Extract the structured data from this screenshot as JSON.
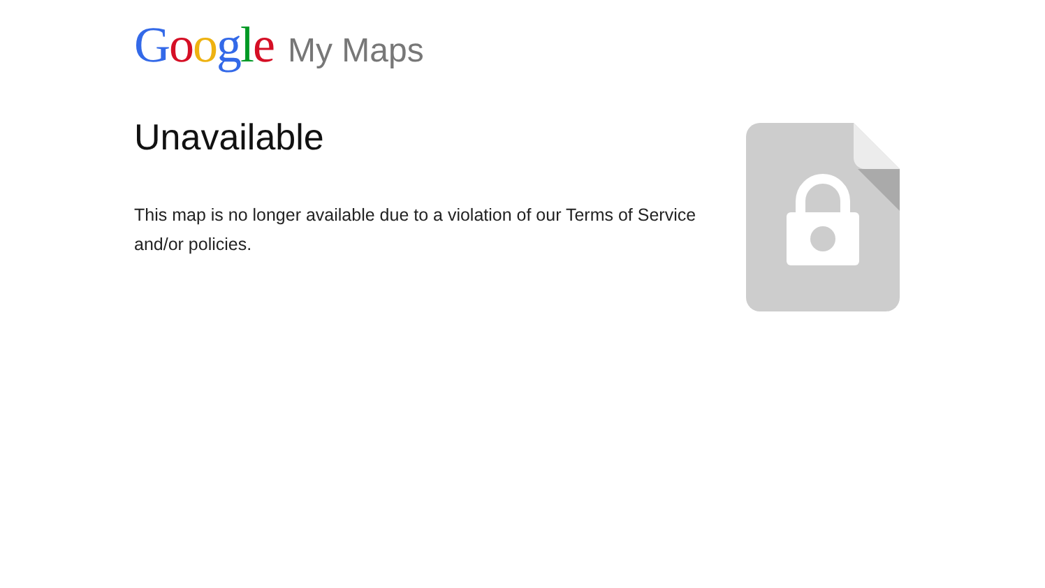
{
  "header": {
    "logo": "Google",
    "product": "My Maps"
  },
  "heading": "Unavailable",
  "message": "This map is no longer available due to a violation of our Terms of Service and/or policies."
}
